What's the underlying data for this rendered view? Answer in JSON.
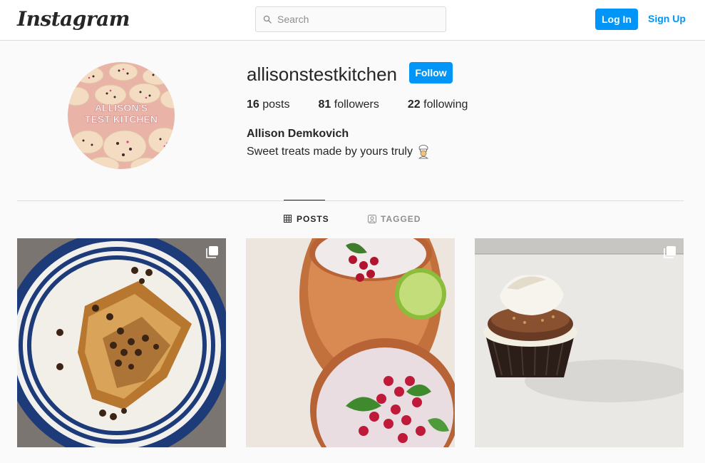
{
  "header": {
    "logo_text": "Instagram",
    "search_placeholder": "Search",
    "login_label": "Log In",
    "signup_label": "Sign Up"
  },
  "profile": {
    "username": "allisonstestkitchen",
    "follow_label": "Follow",
    "avatar_text_line1": "ALLISON'S",
    "avatar_text_line2": "TEST KITCHEN",
    "stats": [
      {
        "count": "16",
        "label": "posts"
      },
      {
        "count": "81",
        "label": "followers"
      },
      {
        "count": "22",
        "label": "following"
      }
    ],
    "full_name": "Allison Demkovich",
    "bio": "Sweet treats made by yours truly",
    "bio_emoji": "cook-emoji"
  },
  "tabs": [
    {
      "label": "POSTS",
      "icon": "grid-icon",
      "active": true
    },
    {
      "label": "TAGGED",
      "icon": "tagged-icon",
      "active": false
    }
  ],
  "posts": [
    {
      "subject": "french-toast-with-chocolate-chips",
      "multiple": true
    },
    {
      "subject": "pomegranate-moscow-mule",
      "multiple": false
    },
    {
      "subject": "smores-cupcake",
      "multiple": true
    }
  ],
  "colors": {
    "accent": "#0095f6",
    "border": "#dbdbdb",
    "text": "#262626",
    "muted": "#8e8e8e",
    "background": "#fafafa"
  }
}
